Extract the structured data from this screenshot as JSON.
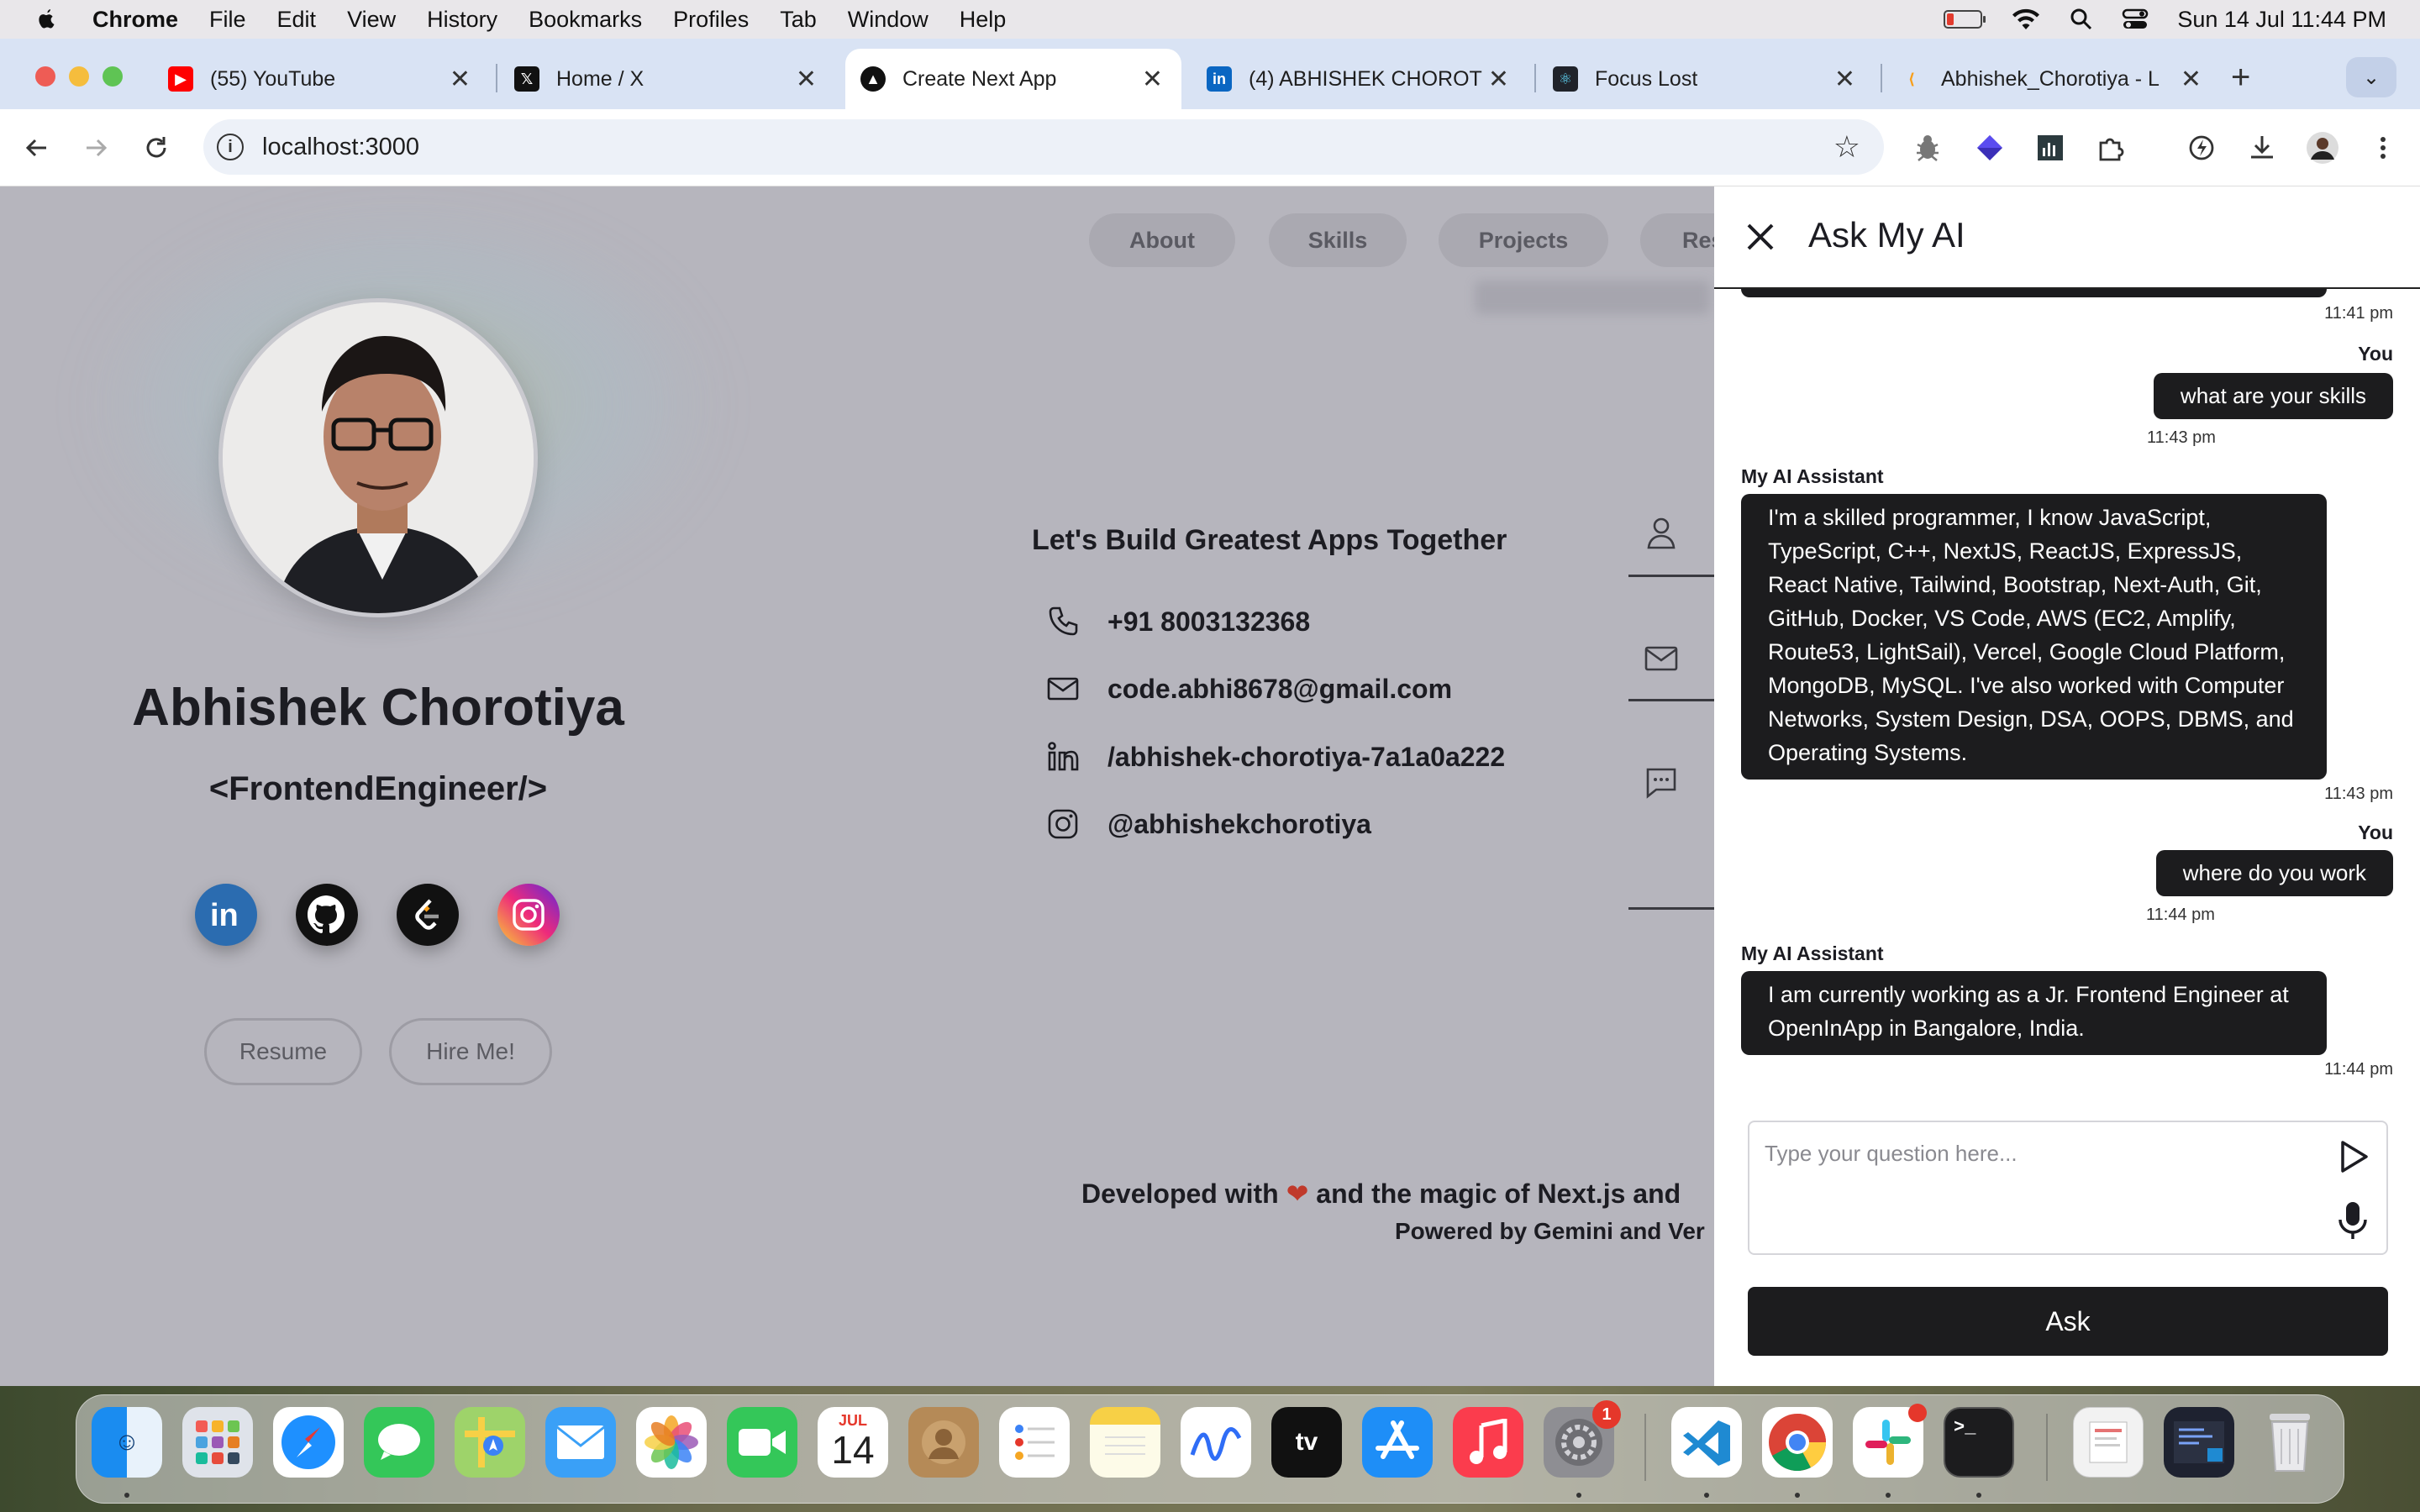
{
  "menubar": {
    "app": "Chrome",
    "items": [
      "File",
      "Edit",
      "View",
      "History",
      "Bookmarks",
      "Profiles",
      "Tab",
      "Window",
      "Help"
    ],
    "datetime": "Sun 14 Jul  11:44 PM"
  },
  "tabs": [
    {
      "label": "(55) YouTube",
      "icon": "youtube-icon"
    },
    {
      "label": "Home / X",
      "icon": "x-icon"
    },
    {
      "label": "Create Next App",
      "icon": "nextjs-icon",
      "active": true
    },
    {
      "label": "(4) ABHISHEK CHOROT",
      "icon": "linkedin-icon"
    },
    {
      "label": "Focus Lost",
      "icon": "react-icon"
    },
    {
      "label": "Abhishek_Chorotiya - L",
      "icon": "leetcode-icon"
    }
  ],
  "address": {
    "url": "localhost:3000"
  },
  "nav": {
    "items": [
      "About",
      "Skills",
      "Projects",
      "Res"
    ]
  },
  "profile": {
    "name": "Abhishek Chorotiya",
    "role": "<FrontendEngineer/>",
    "resume_label": "Resume",
    "hire_label": "Hire Me!"
  },
  "contact": {
    "title": "Let's Build Greatest Apps Together",
    "phone": "+91 8003132368",
    "email": "code.abhi8678@gmail.com",
    "linkedin": "/abhishek-chorotiya-7a1a0a222",
    "instagram": "@abhishekchorotiya"
  },
  "footer": {
    "line1_pre": "Developed with",
    "heart": "❤",
    "line1_post": "and the magic of Next.js and",
    "line2": "Powered by Gemini and Ver"
  },
  "chat": {
    "title": "Ask My AI",
    "messages": [
      {
        "time": "11:41 pm"
      },
      {
        "sender": "You",
        "text": "what are your skills",
        "time": "11:43 pm"
      },
      {
        "sender": "My AI Assistant",
        "text": "I'm a skilled programmer, I know JavaScript, TypeScript, C++, NextJS, ReactJS, ExpressJS, React Native, Tailwind, Bootstrap, Next-Auth, Git, GitHub, Docker, VS Code, AWS (EC2, Amplify, Route53, LightSail), Vercel, Google Cloud Platform, MongoDB, MySQL. I've also worked with Computer Networks, System Design, DSA, OOPS, DBMS, and Operating Systems.",
        "time": "11:43 pm"
      },
      {
        "sender": "You",
        "text": "where do you work",
        "time": "11:44 pm"
      },
      {
        "sender": "My AI Assistant",
        "text": "I am currently working as a Jr. Frontend Engineer at OpenInApp in Bangalore, India.",
        "time": "11:44 pm"
      }
    ],
    "input_placeholder": "Type your question here...",
    "ask_label": "Ask"
  },
  "dock": {
    "calendar_month": "JUL",
    "calendar_day": "14",
    "settings_badge": "1",
    "apps": [
      "finder-icon",
      "launchpad-icon",
      "safari-icon",
      "messages-icon",
      "maps-icon",
      "mail-icon",
      "photos-icon",
      "facetime-icon",
      "calendar-icon",
      "contacts-icon",
      "reminders-icon",
      "notes-icon",
      "freeform-icon",
      "appletv-icon",
      "appstore-icon",
      "music-icon",
      "settings-icon",
      "vscode-icon",
      "chrome-icon",
      "slack-icon",
      "terminal-icon",
      "trash-icon"
    ]
  },
  "colors": {
    "page_overlay": "#b6b5bd",
    "chat_bubble": "#1c1c1e",
    "tabstrip": "#d9e3f4"
  }
}
